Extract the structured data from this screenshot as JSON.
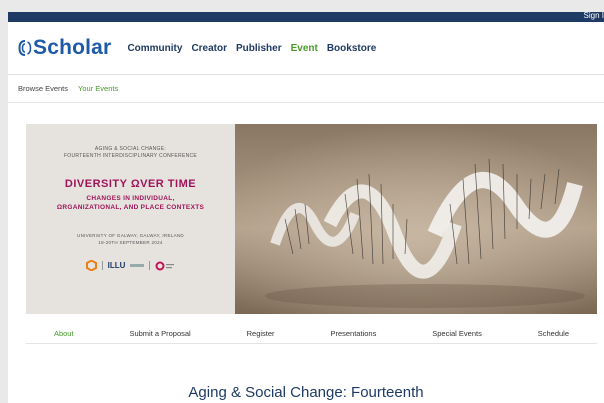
{
  "topbar": {
    "signin": "Sign I"
  },
  "logo": {
    "text": "Scholar"
  },
  "nav": [
    "Community",
    "Creator",
    "Publisher",
    "Event",
    "Bookstore"
  ],
  "subnav": [
    "Browse Events",
    "Your Events"
  ],
  "banner": {
    "subtitle_line1": "AGING & SOCIAL CHANGE:",
    "subtitle_line2": "FOURTEENTH INTERDISCIPLINARY CONFERENCE",
    "title": "DIVERSITY ΩVER TIME",
    "title2_line1": "CHANGES IN INDIVIDUAL,",
    "title2_line2": "ΩRGANIZATIONAL, AND PLACE CONTEXTS",
    "location_line1": "UNIVERSITY OF GALWAY, GALWAY, IRELAND",
    "location_line2": "18-20TH SEPTEMBER 2024",
    "logo_text": "ILLU"
  },
  "tabs": [
    "About",
    "Submit a Proposal",
    "Register",
    "Presentations",
    "Special Events",
    "Schedule"
  ],
  "page": {
    "title": "Aging & Social Change: Fourteenth"
  },
  "colors": {
    "brand": "#1e5aa8",
    "navy": "#1f3a64",
    "active": "#4a9a2a",
    "magenta": "#a0135a"
  }
}
